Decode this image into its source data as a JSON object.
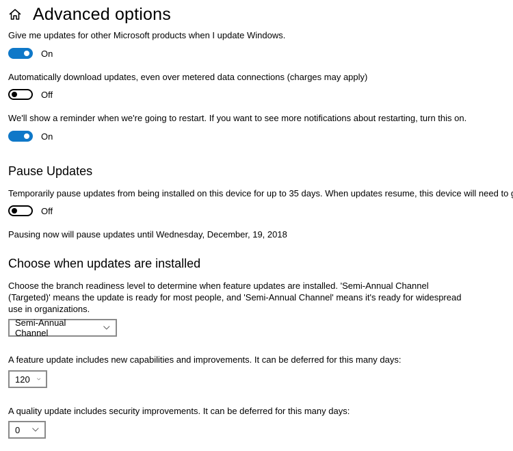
{
  "header": {
    "icon": "home-icon",
    "title": "Advanced options"
  },
  "settings": [
    {
      "description": "Give me updates for other Microsoft products when I update Windows.",
      "state": "on",
      "state_label": "On"
    },
    {
      "description": "Automatically download updates, even over metered data connections (charges may apply)",
      "state": "off",
      "state_label": "Off"
    },
    {
      "description": "We'll show a reminder when we're going to restart. If you want to see more notifications about restarting, turn this on.",
      "state": "on",
      "state_label": "On"
    }
  ],
  "pause": {
    "title": "Pause Updates",
    "description": "Temporarily pause updates from being installed on this device for up to 35 days. When updates resume, this device will need to get",
    "state": "off",
    "state_label": "Off",
    "note": "Pausing now will pause updates until Wednesday, December, 19, 2018"
  },
  "choose": {
    "title": "Choose when updates are installed",
    "description": "Choose the branch readiness level to determine when feature updates are installed. 'Semi-Annual Channel (Targeted)' means the update is ready for most people, and 'Semi-Annual Channel' means it's ready for widespread use in organizations.",
    "branch_select": "Semi-Annual Channel",
    "feature_label": "A feature update includes new capabilities and improvements. It can be deferred for this many days:",
    "feature_days": "120",
    "quality_label": "A quality update includes security improvements. It can be deferred for this many days:",
    "quality_days": "0"
  },
  "colors": {
    "accent": "#0f78c8"
  }
}
